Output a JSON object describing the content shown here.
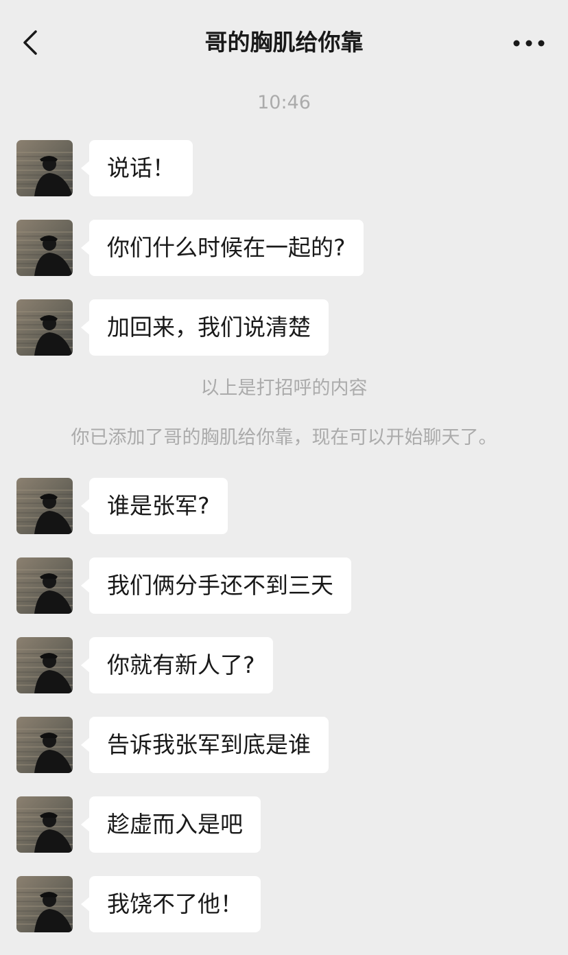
{
  "header": {
    "title": "哥的胸肌给你靠",
    "back_icon": "chevron-left-icon",
    "more_icon": "more-dots-icon"
  },
  "timestamp": "10:46",
  "messages_before": [
    {
      "text": "说话！"
    },
    {
      "text": "你们什么时候在一起的?"
    },
    {
      "text": "加回来，我们说清楚"
    }
  ],
  "system": {
    "greeting_note": "以上是打招呼的内容",
    "added_note": "你已添加了哥的胸肌给你靠，现在可以开始聊天了。"
  },
  "messages_after": [
    {
      "text": "谁是张军?"
    },
    {
      "text": "我们俩分手还不到三天"
    },
    {
      "text": "你就有新人了?"
    },
    {
      "text": "告诉我张军到底是谁"
    },
    {
      "text": "趁虚而入是吧"
    },
    {
      "text": "我饶不了他！"
    }
  ],
  "colors": {
    "background": "#ededed",
    "bubble": "#ffffff",
    "text": "#191919",
    "system_text": "#ababab"
  }
}
